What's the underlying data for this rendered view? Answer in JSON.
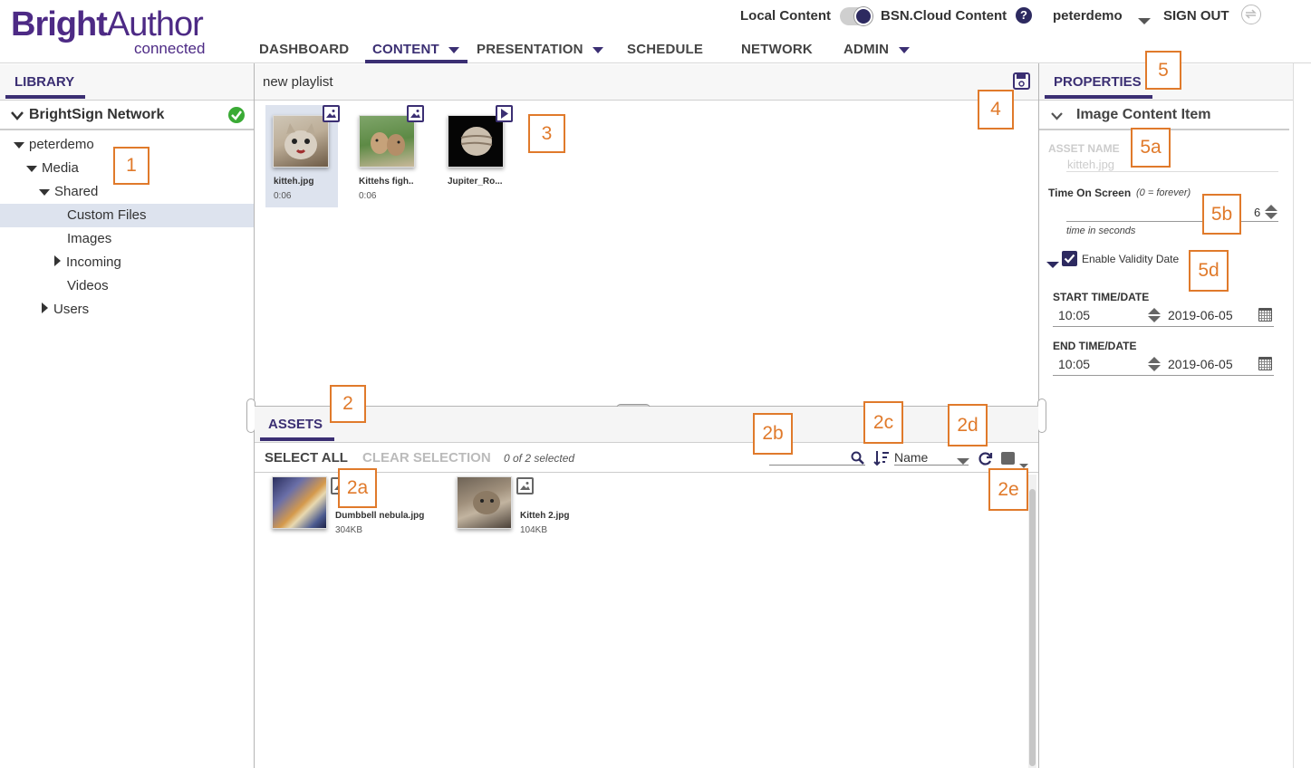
{
  "header": {
    "logo_bright": "Bright",
    "logo_author": "Author",
    "logo_sub": "connected",
    "local_content": "Local Content",
    "cloud_content": "BSN.Cloud Content",
    "help": "?",
    "user": "peterdemo",
    "sign_out": "SIGN OUT"
  },
  "nav": {
    "items": [
      {
        "label": "DASHBOARD"
      },
      {
        "label": "CONTENT"
      },
      {
        "label": "PRESENTATION"
      },
      {
        "label": "SCHEDULE"
      },
      {
        "label": "NETWORK"
      },
      {
        "label": "ADMIN"
      }
    ],
    "active": "CONTENT"
  },
  "library": {
    "tab": "LIBRARY",
    "network": "BrightSign Network",
    "tree": [
      {
        "label": "peterdemo"
      },
      {
        "label": "Media"
      },
      {
        "label": "Shared"
      },
      {
        "label": "Custom Files"
      },
      {
        "label": "Images"
      },
      {
        "label": "Incoming"
      },
      {
        "label": "Videos"
      },
      {
        "label": "Users"
      }
    ]
  },
  "playlist": {
    "title": "new playlist",
    "items": [
      {
        "name": "kitteh.jpg",
        "duration": "0:06",
        "icon": "image-icon"
      },
      {
        "name": "Kittehs figh..",
        "duration": "0:06",
        "icon": "image-icon"
      },
      {
        "name": "Jupiter_Ro...",
        "duration": "",
        "icon": "video-icon"
      }
    ]
  },
  "assets": {
    "tab": "ASSETS",
    "select_all": "SELECT ALL",
    "clear_selection": "CLEAR SELECTION",
    "selected_count": "0 of 2 selected",
    "sort_value": "Name",
    "items": [
      {
        "name": "Dumbbell nebula.jpg",
        "size": "304KB"
      },
      {
        "name": "Kitteh 2.jpg",
        "size": "104KB"
      }
    ]
  },
  "properties": {
    "tab": "PROPERTIES",
    "section": "Image Content Item",
    "asset_name_label": "ASSET NAME",
    "asset_name_value": "kitteh.jpg",
    "time_on_screen_label": "Time On Screen",
    "time_on_screen_hint": "(0 = forever)",
    "time_value": "6",
    "time_unit": "time in seconds",
    "validity_label": "Enable Validity Date",
    "start_label": "START TIME/DATE",
    "start_time": "10:05",
    "start_date": "2019-06-05",
    "end_label": "END TIME/DATE",
    "end_time": "10:05",
    "end_date": "2019-06-05"
  },
  "annotations": [
    "1",
    "2",
    "2a",
    "2b",
    "2c",
    "2d",
    "2e",
    "3",
    "4",
    "5",
    "5a",
    "5b",
    "5d"
  ],
  "colors": {
    "brand": "#4d2a85",
    "accent": "#3b2f73",
    "annotation": "#e07a2b",
    "ok": "#3aaa35"
  }
}
